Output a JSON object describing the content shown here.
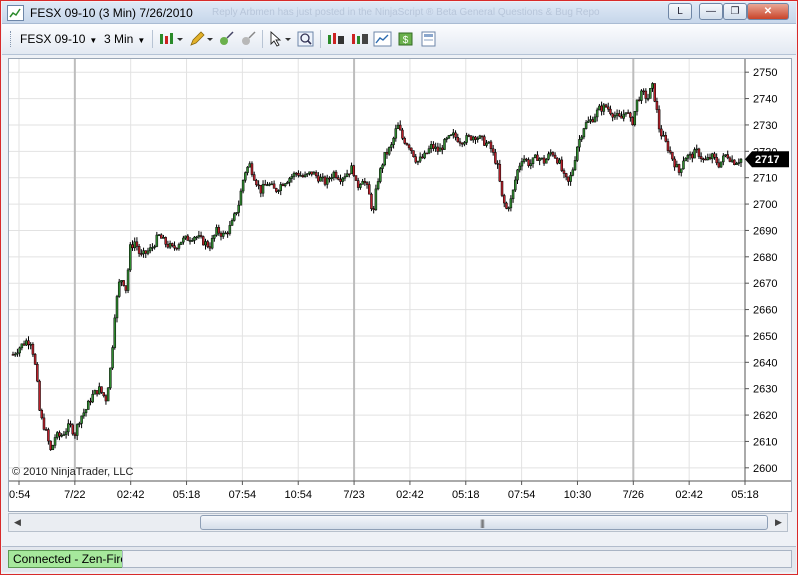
{
  "window": {
    "title": "FESX 09-10 (3 Min)  7/26/2010",
    "background_ghost_text": "Reply  Arbmen has just posted in the NinjaScript ® Beta General Questions & Bug Repo",
    "layout_label": "L"
  },
  "toolbar": {
    "instrument": "FESX 09-10",
    "interval": "3 Min"
  },
  "chart": {
    "copyright": "© 2010 NinjaTrader, LLC",
    "last_price_label": "2717",
    "colors": {
      "up": "#2f8a2f",
      "down": "#b8202a",
      "wick": "#000000",
      "grid": "#e2e2e2",
      "session_line": "#bdbdbd",
      "price_tag": "#000000"
    }
  },
  "chart_data": {
    "type": "candlestick",
    "ylim": [
      2595,
      2755
    ],
    "y_ticks": [
      2600,
      2610,
      2620,
      2630,
      2640,
      2650,
      2660,
      2670,
      2680,
      2690,
      2700,
      2710,
      2720,
      2730,
      2740,
      2750
    ],
    "x_tick_labels": [
      "0:54",
      "7/22",
      "02:42",
      "05:18",
      "07:54",
      "10:54",
      "7/23",
      "02:42",
      "05:18",
      "07:54",
      "10:30",
      "7/26",
      "02:42",
      "05:18"
    ],
    "last_price": 2717,
    "close_path": [
      [
        0,
        2643
      ],
      [
        0.01,
        2646
      ],
      [
        0.018,
        2648
      ],
      [
        0.025,
        2648
      ],
      [
        0.032,
        2636
      ],
      [
        0.037,
        2620
      ],
      [
        0.045,
        2614
      ],
      [
        0.052,
        2606
      ],
      [
        0.058,
        2612
      ],
      [
        0.065,
        2612
      ],
      [
        0.072,
        2614
      ],
      [
        0.078,
        2616
      ],
      [
        0.085,
        2613
      ],
      [
        0.092,
        2619
      ],
      [
        0.1,
        2622
      ],
      [
        0.108,
        2627
      ],
      [
        0.118,
        2630
      ],
      [
        0.128,
        2626
      ],
      [
        0.135,
        2640
      ],
      [
        0.14,
        2659
      ],
      [
        0.146,
        2670
      ],
      [
        0.15,
        2672
      ],
      [
        0.156,
        2667
      ],
      [
        0.16,
        2683
      ],
      [
        0.168,
        2686
      ],
      [
        0.175,
        2680
      ],
      [
        0.19,
        2683
      ],
      [
        0.2,
        2688
      ],
      [
        0.21,
        2685
      ],
      [
        0.22,
        2683
      ],
      [
        0.23,
        2686
      ],
      [
        0.24,
        2687
      ],
      [
        0.25,
        2688
      ],
      [
        0.26,
        2686
      ],
      [
        0.27,
        2684
      ],
      [
        0.28,
        2690
      ],
      [
        0.29,
        2688
      ],
      [
        0.3,
        2692
      ],
      [
        0.31,
        2700
      ],
      [
        0.318,
        2712
      ],
      [
        0.325,
        2715
      ],
      [
        0.332,
        2710
      ],
      [
        0.34,
        2705
      ],
      [
        0.35,
        2708
      ],
      [
        0.36,
        2705
      ],
      [
        0.37,
        2708
      ],
      [
        0.38,
        2710
      ],
      [
        0.39,
        2712
      ],
      [
        0.4,
        2710
      ],
      [
        0.41,
        2712
      ],
      [
        0.42,
        2710
      ],
      [
        0.43,
        2708
      ],
      [
        0.44,
        2712
      ],
      [
        0.45,
        2710
      ],
      [
        0.46,
        2712
      ],
      [
        0.467,
        2714
      ],
      [
        0.472,
        2706
      ],
      [
        0.48,
        2710
      ],
      [
        0.488,
        2705
      ],
      [
        0.495,
        2696
      ],
      [
        0.5,
        2708
      ],
      [
        0.51,
        2718
      ],
      [
        0.52,
        2722
      ],
      [
        0.528,
        2730
      ],
      [
        0.535,
        2725
      ],
      [
        0.545,
        2722
      ],
      [
        0.555,
        2716
      ],
      [
        0.565,
        2718
      ],
      [
        0.575,
        2722
      ],
      [
        0.585,
        2720
      ],
      [
        0.595,
        2724
      ],
      [
        0.605,
        2726
      ],
      [
        0.615,
        2724
      ],
      [
        0.625,
        2725
      ],
      [
        0.635,
        2726
      ],
      [
        0.645,
        2724
      ],
      [
        0.655,
        2722
      ],
      [
        0.665,
        2715
      ],
      [
        0.672,
        2702
      ],
      [
        0.678,
        2698
      ],
      [
        0.685,
        2702
      ],
      [
        0.692,
        2712
      ],
      [
        0.7,
        2718
      ],
      [
        0.71,
        2715
      ],
      [
        0.72,
        2718
      ],
      [
        0.73,
        2716
      ],
      [
        0.74,
        2720
      ],
      [
        0.75,
        2716
      ],
      [
        0.757,
        2710
      ],
      [
        0.763,
        2708
      ],
      [
        0.768,
        2712
      ],
      [
        0.775,
        2722
      ],
      [
        0.785,
        2730
      ],
      [
        0.795,
        2732
      ],
      [
        0.805,
        2736
      ],
      [
        0.815,
        2737
      ],
      [
        0.825,
        2734
      ],
      [
        0.835,
        2732
      ],
      [
        0.842,
        2736
      ],
      [
        0.85,
        2730
      ],
      [
        0.858,
        2740
      ],
      [
        0.865,
        2742
      ],
      [
        0.872,
        2740
      ],
      [
        0.878,
        2745
      ],
      [
        0.883,
        2738
      ],
      [
        0.888,
        2728
      ],
      [
        0.895,
        2724
      ],
      [
        0.902,
        2720
      ],
      [
        0.908,
        2716
      ],
      [
        0.915,
        2712
      ],
      [
        0.922,
        2718
      ],
      [
        0.93,
        2718
      ],
      [
        0.94,
        2720
      ],
      [
        0.95,
        2716
      ],
      [
        0.96,
        2718
      ],
      [
        0.97,
        2715
      ],
      [
        0.98,
        2719
      ],
      [
        0.99,
        2716
      ],
      [
        1.0,
        2717
      ]
    ]
  }
}
